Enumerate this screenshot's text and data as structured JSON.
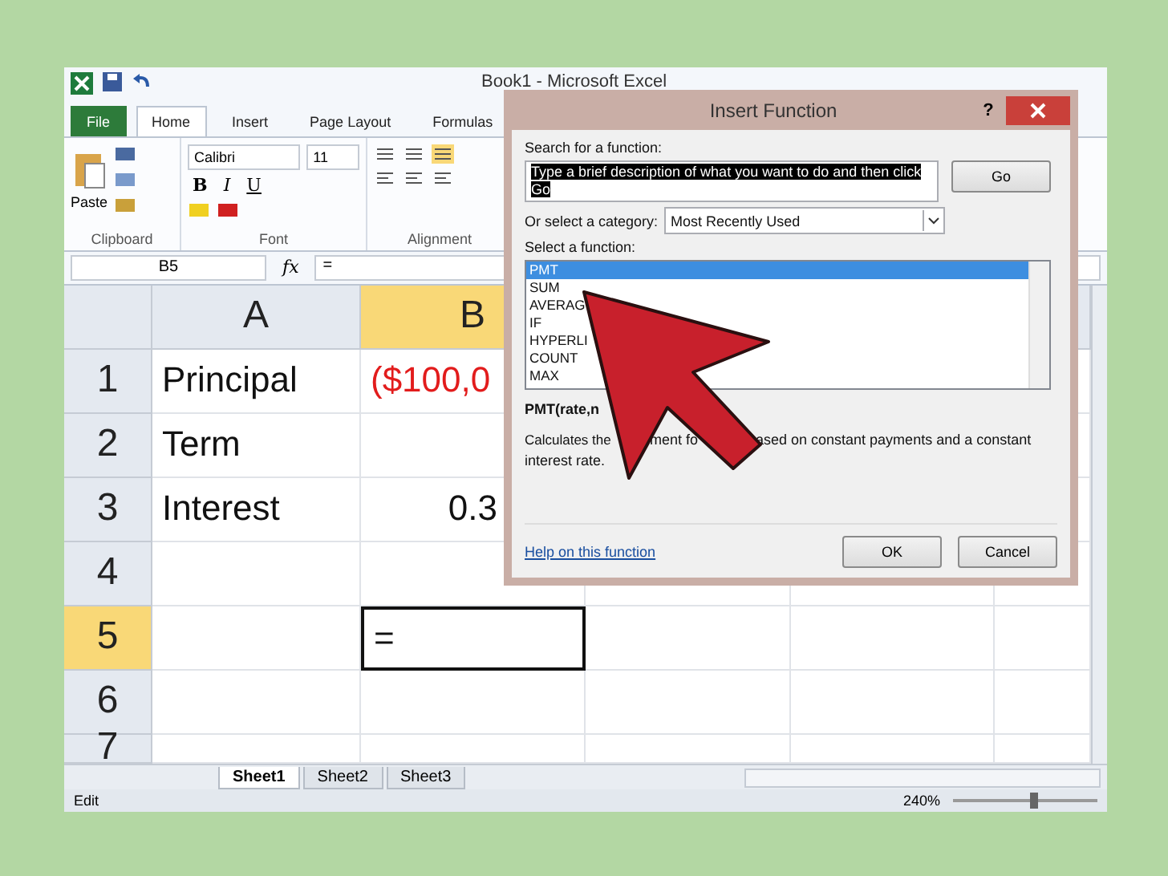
{
  "window": {
    "title": "Book1 - Microsoft Excel"
  },
  "ribbon_tabs": [
    {
      "label": "File",
      "kind": "file",
      "selected": false
    },
    {
      "label": "Home",
      "kind": "tab",
      "selected": true
    },
    {
      "label": "Insert",
      "kind": "tab",
      "selected": false
    },
    {
      "label": "Page Layout",
      "kind": "tab",
      "selected": false
    },
    {
      "label": "Formulas",
      "kind": "tab",
      "selected": false
    }
  ],
  "ribbon": {
    "paste_label": "Paste",
    "font_name": "Calibri",
    "font_size": "11",
    "format_buttons": [
      "B",
      "I",
      "U"
    ],
    "groups": [
      "Clipboard",
      "Font",
      "Alignment"
    ]
  },
  "formula_bar": {
    "name_box": "B5",
    "fx": "fx",
    "value": "="
  },
  "sheet": {
    "columns": [
      {
        "label": "A",
        "selected": false
      },
      {
        "label": "B",
        "selected": true
      }
    ],
    "rows": [
      {
        "label": "1",
        "selected": false,
        "cells": [
          {
            "text": "Principal",
            "kind": "text",
            "active": false
          },
          {
            "text": "($100,0",
            "kind": "negative",
            "active": false
          }
        ]
      },
      {
        "label": "2",
        "selected": false,
        "cells": [
          {
            "text": "Term",
            "kind": "text",
            "active": false
          },
          {
            "kind": "text",
            "active": false
          }
        ]
      },
      {
        "label": "3",
        "selected": false,
        "cells": [
          {
            "text": "Interest",
            "kind": "text",
            "active": false
          },
          {
            "text": "0.3",
            "kind": "number",
            "active": false
          }
        ]
      },
      {
        "label": "4",
        "selected": false,
        "cells": [
          {
            "kind": "text",
            "active": false
          },
          {
            "kind": "text",
            "active": false
          }
        ]
      },
      {
        "label": "5",
        "selected": true,
        "cells": [
          {
            "kind": "text",
            "active": false
          },
          {
            "text": "=",
            "kind": "text",
            "active": true
          }
        ]
      },
      {
        "label": "6",
        "selected": false,
        "cells": [
          {
            "kind": "text",
            "active": false
          },
          {
            "kind": "text",
            "active": false
          }
        ]
      },
      {
        "label": "7",
        "selected": false,
        "cells": [
          {
            "kind": "text",
            "active": false
          },
          {
            "kind": "text",
            "active": false
          }
        ]
      }
    ]
  },
  "sheet_tabs": [
    {
      "label": "Sheet1",
      "selected": true
    },
    {
      "label": "Sheet2",
      "selected": false
    },
    {
      "label": "Sheet3",
      "selected": false
    }
  ],
  "status_bar": {
    "mode": "Edit",
    "zoom": "240%",
    "zoom_slider": {
      "level": 0.55
    }
  },
  "dialog": {
    "title": "Insert Function",
    "help_glyph": "?",
    "search_label": "Search for a function:",
    "search_value": "Type a brief description of what you want to do and then click Go",
    "go_button": "Go",
    "category_label": "Or select a category:",
    "category_value": "Most Recently Used",
    "function_label": "Select a function:",
    "functions": [
      {
        "name": "PMT",
        "selected": true
      },
      {
        "name": "SUM",
        "selected": false
      },
      {
        "name": "AVERAG",
        "selected": false
      },
      {
        "name": "IF",
        "selected": false
      },
      {
        "name": "HYPERLI",
        "selected": false
      },
      {
        "name": "COUNT",
        "selected": false
      },
      {
        "name": "MAX",
        "selected": false
      }
    ],
    "signature": "PMT(rate,n",
    "description_parts": [
      "Calculates the",
      "ment fo",
      "ased on constant payments and a constant"
    ],
    "description_line2": "interest rate.",
    "help_link": "Help on this function",
    "ok_button": "OK",
    "cancel_button": "Cancel"
  }
}
